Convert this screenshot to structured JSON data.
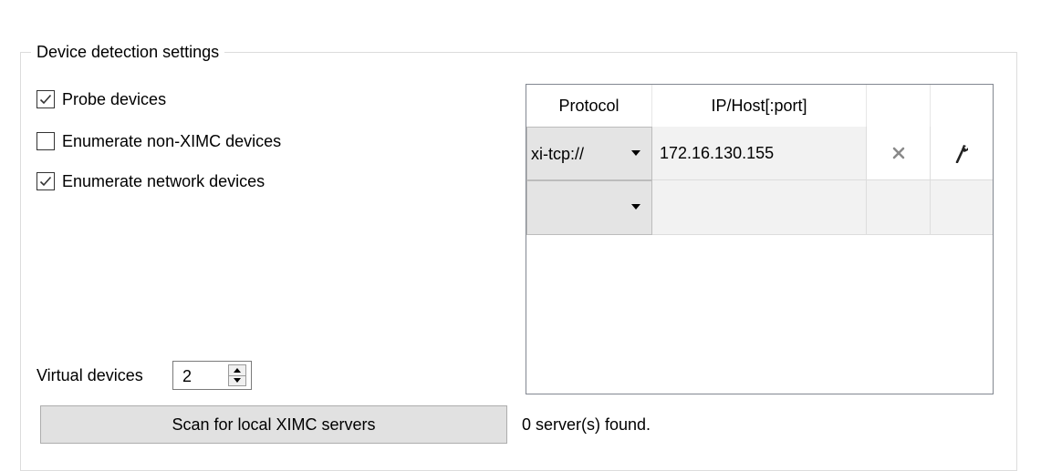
{
  "group": {
    "title": "Device detection settings"
  },
  "options": {
    "probe": {
      "label": "Probe devices",
      "checked": true
    },
    "non_ximc": {
      "label": "Enumerate non-XIMC devices",
      "checked": false
    },
    "network": {
      "label": "Enumerate network devices",
      "checked": true
    }
  },
  "virtual_devices": {
    "label": "Virtual devices",
    "value": "2"
  },
  "scan": {
    "button_label": "Scan for local XIMC servers",
    "status": "0 server(s) found."
  },
  "table": {
    "columns": [
      "Protocol",
      "IP/Host[:port]"
    ],
    "rows": [
      {
        "protocol": "xi-tcp://",
        "host": "172.16.130.155",
        "remove_icon": "close-icon",
        "edit_icon": "wrench-icon"
      },
      {
        "protocol": "",
        "host": ""
      }
    ]
  },
  "colors": {
    "group_border": "#dcdcdc",
    "combo_bg": "#e4e4e4",
    "button_bg": "#e1e1e1",
    "icon_gray": "#8a8a8a"
  }
}
